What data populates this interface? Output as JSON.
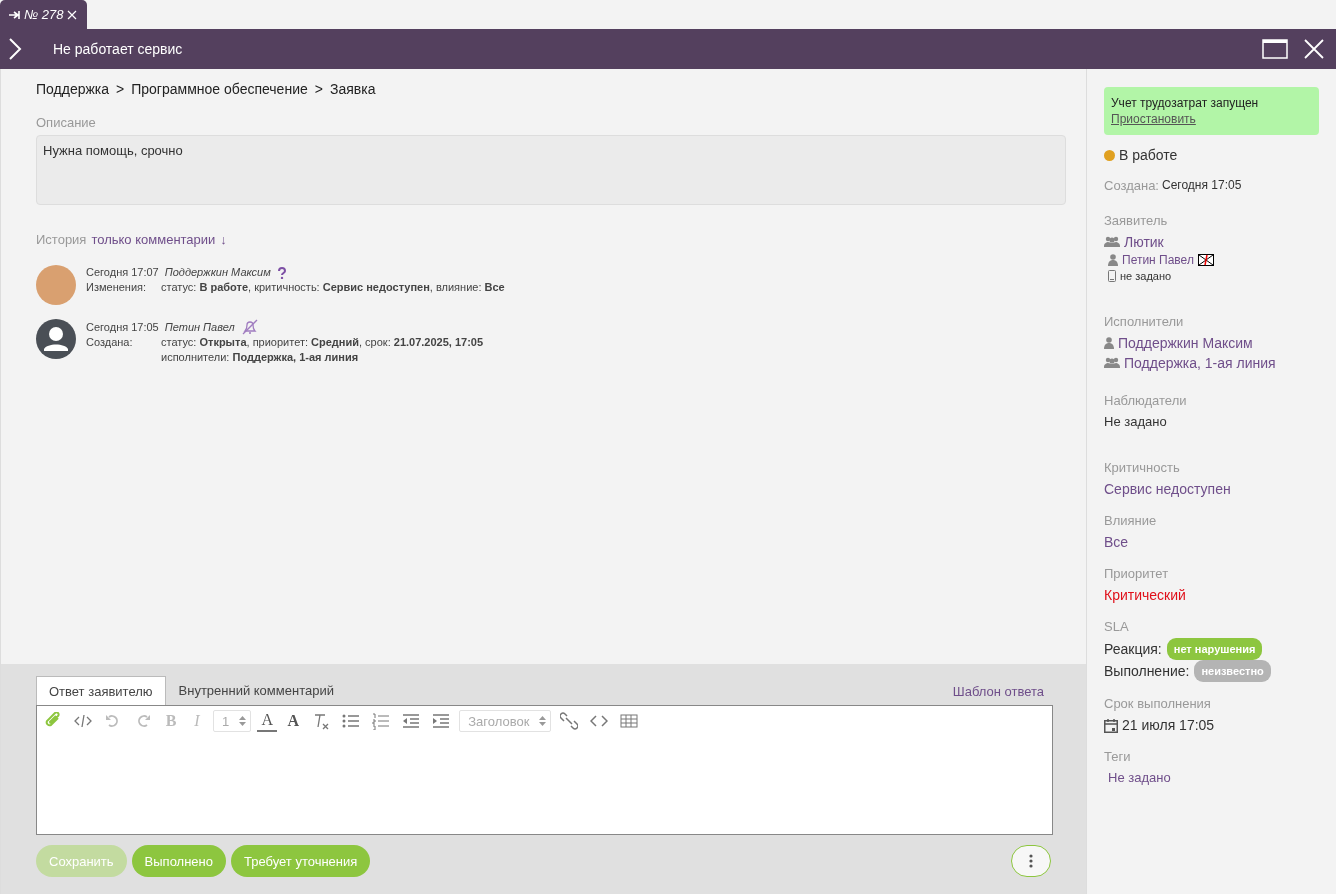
{
  "tab": {
    "label": "№ 278",
    "selected": true
  },
  "header": {
    "title": "Не работает сервис"
  },
  "breadcrumbs": [
    "Поддержка",
    "Программное обеспечение",
    "Заявка"
  ],
  "breadcrumb_separator": ">",
  "description": {
    "label": "Описание",
    "value": "Нужна помощь, срочно"
  },
  "history": {
    "label": "История",
    "filter": "только комментарии",
    "filter_arrow": "↓",
    "entries": [
      {
        "avatar": {
          "kind": "photo"
        },
        "time": "Сегодня 17:07",
        "author": "Поддержкин Максим",
        "badge": {
          "kind": "question"
        },
        "lines": [
          {
            "label": "Изменения:",
            "text": "статус: **В работе**, критичность: **Сервис недоступен**, влияние: **Все**"
          }
        ]
      },
      {
        "avatar": {
          "kind": "default"
        },
        "time": "Сегодня 17:05",
        "author": "Петин Павел",
        "badge": {
          "kind": "bell-off"
        },
        "lines": [
          {
            "label": "Создана:",
            "text": "статус: **Открыта**, приоритет: **Средний**, срок: **21.07.2025, 17:05**"
          },
          {
            "text": "исполнители:  **Поддержка, 1-ая линия**"
          }
        ]
      }
    ]
  },
  "reply": {
    "tabs": [
      {
        "label": "Ответ заявителю",
        "selected": true
      },
      {
        "label": "Внутренний комментарий",
        "selected": false
      }
    ],
    "template_link": "Шаблон ответа",
    "toolbar": [
      {
        "kind": "attach",
        "disabled": false
      },
      {
        "kind": "source",
        "disabled": false
      },
      {
        "kind": "undo",
        "disabled": true
      },
      {
        "kind": "redo",
        "disabled": true
      },
      {
        "kind": "bold",
        "text": "B",
        "disabled": true
      },
      {
        "kind": "italic",
        "text": "I",
        "disabled": true
      },
      {
        "kind": "select",
        "text": "1",
        "disabled": false
      },
      {
        "kind": "font-color",
        "text": "A",
        "disabled": false
      },
      {
        "kind": "back-color",
        "text": "A",
        "disabled": false
      },
      {
        "kind": "clear",
        "disabled": false
      },
      {
        "kind": "bullets",
        "disabled": false
      },
      {
        "kind": "numbers",
        "disabled": false
      },
      {
        "kind": "outdent",
        "disabled": false
      },
      {
        "kind": "indent",
        "disabled": false
      },
      {
        "kind": "select",
        "text": "Заголовок",
        "disabled": false
      },
      {
        "kind": "link",
        "disabled": false
      },
      {
        "kind": "code",
        "disabled": false
      },
      {
        "kind": "table",
        "disabled": false
      }
    ],
    "buttons": [
      {
        "label": "Сохранить",
        "disabled": true
      },
      {
        "label": "Выполнено",
        "disabled": false
      },
      {
        "label": "Требует уточнения",
        "disabled": false
      }
    ]
  },
  "sidebar": {
    "timer": {
      "text": "Учет трудозатрат запущен",
      "link": "Приостановить"
    },
    "status": {
      "label": "В работе",
      "color": "#e0a020"
    },
    "created": {
      "label": "Создана:",
      "value": "Сегодня 17:05"
    },
    "applicant": {
      "label": "Заявитель",
      "group": "Лютик",
      "person": "Петин Павел",
      "phone": "не задано"
    },
    "assignees": {
      "label": "Исполнители",
      "items": [
        {
          "kind": "person",
          "name": "Поддержкин Максим"
        },
        {
          "kind": "group",
          "name": "Поддержка, 1-ая линия"
        }
      ]
    },
    "observers": {
      "label": "Наблюдатели",
      "value": "Не задано"
    },
    "fields": [
      {
        "label": "Критичность",
        "value": "Сервис недоступен",
        "kind": "link"
      },
      {
        "label": "Влияние",
        "value": "Все",
        "kind": "link"
      },
      {
        "label": "Приоритет",
        "value": "Критический",
        "kind": "alert"
      }
    ],
    "sla": {
      "label": "SLA",
      "rows": [
        {
          "label": "Реакция:",
          "badge": "нет нарушения",
          "color": "#8dc63f"
        },
        {
          "label": "Выполнение:",
          "badge": "неизвестно",
          "color": "#b4b4b4"
        }
      ]
    },
    "due": {
      "label": "Срок выполнения",
      "value": "21 июля 17:05"
    },
    "tags": {
      "label": "Теги",
      "value": "Не задано"
    }
  }
}
